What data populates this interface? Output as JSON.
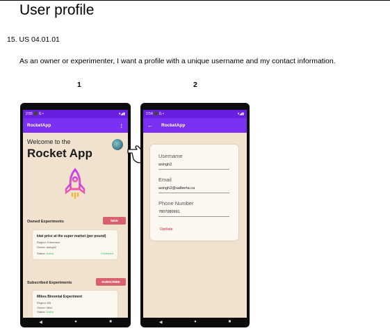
{
  "doc": {
    "title": "User profile",
    "story_id": "15. US 04.01.01",
    "story_text": "As an owner or experimenter, I want a profile with a unique username and my contact information.",
    "label_1": "1",
    "label_2": "2"
  },
  "phone1": {
    "status_time": "2:55",
    "status_icons": "⬛ G •",
    "status_right": "▾◢▮",
    "app_title": "RocketApp",
    "menu_icon": "⋮",
    "welcome": "Welcome to the",
    "hero_title": "Rocket App",
    "owned_label": "Owned Experiments",
    "new_button": "NEW",
    "card1": {
      "title": "kiwi price at the super market (per pound)",
      "region": "Region: Edmonton",
      "owner": "Owner: asingh2",
      "status_label": "Status:",
      "status_value": "Active",
      "published": "Published"
    },
    "subscribed_label": "Subscribed Experiments",
    "subscribe_button": "SUBSCRIBE",
    "card2": {
      "title": "Mikes Binomial Experiment",
      "region": "Region: AB",
      "owner": "Owner: Mike",
      "status_label": "Status:",
      "status_value": "Active"
    },
    "nav": {
      "back": "◀",
      "home": "●",
      "recent": "■"
    }
  },
  "phone2": {
    "status_time": "2:54",
    "status_icons": "⬛ G •",
    "status_right": "▾◢▮",
    "back_icon": "←",
    "app_title": "RocketApp",
    "username_label": "Username",
    "username_value": "asingh2",
    "email_label": "Email",
    "email_value": "asingh2@ualberta.ca",
    "phone_label": "Phone Number",
    "phone_value": "7807080991",
    "update_label": "Update",
    "nav": {
      "back": "◀",
      "home": "●",
      "recent": "■"
    }
  },
  "colors": {
    "app_bar": "#7b2ff2",
    "status_bar": "#6a1fe0",
    "screen_bg": "#f0e2cf",
    "accent_pink": "#d9606f",
    "active_green": "#35c25b"
  }
}
